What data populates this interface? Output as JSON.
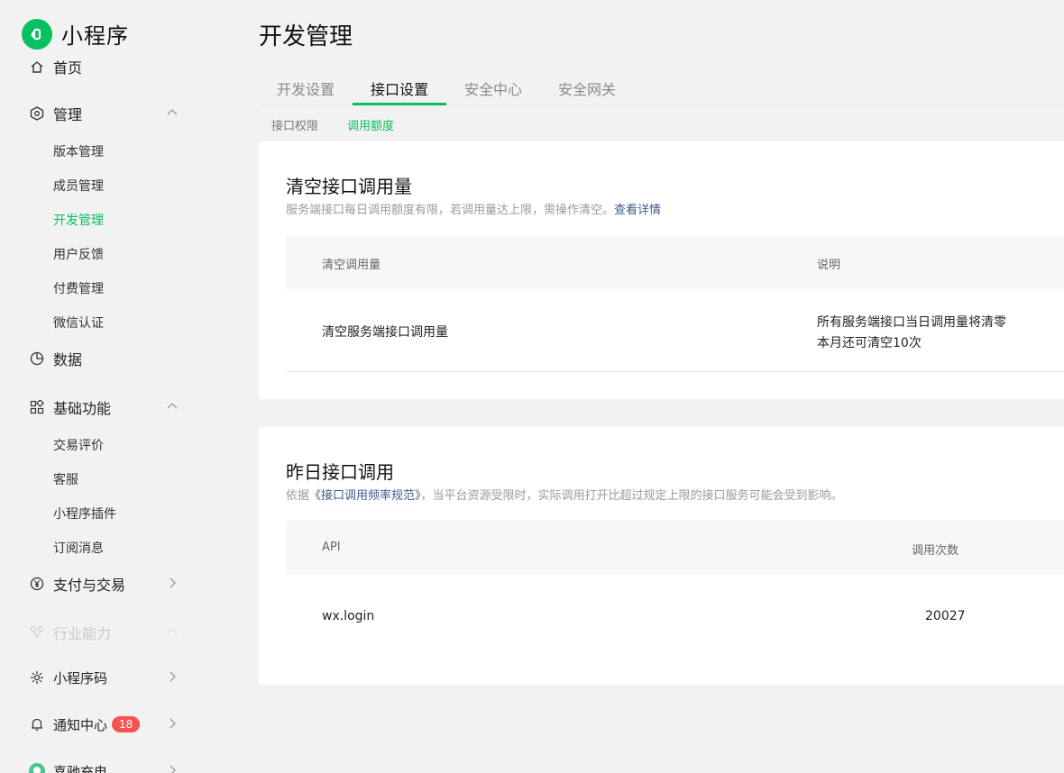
{
  "app": {
    "name": "小程序"
  },
  "sidebar": {
    "home_label": "首页",
    "groups": {
      "manage": {
        "label": "管理",
        "items": [
          "版本管理",
          "成员管理",
          "开发管理",
          "用户反馈",
          "付费管理",
          "微信认证"
        ],
        "active": "开发管理"
      },
      "data": {
        "label": "数据"
      },
      "basic": {
        "label": "基础功能",
        "items": [
          "交易评价",
          "客服",
          "小程序插件",
          "订阅消息"
        ]
      },
      "pay": {
        "label": "支付与交易"
      },
      "industry": {
        "label": "行业能力"
      },
      "qrcode": {
        "label": "小程序码"
      },
      "notify": {
        "label": "通知中心",
        "badge": "18"
      },
      "account": {
        "label": "喜驰充电"
      }
    }
  },
  "page": {
    "title": "开发管理",
    "tabs": [
      "开发设置",
      "接口设置",
      "安全中心",
      "安全网关"
    ],
    "active_tab": "接口设置",
    "subtabs": [
      "接口权限",
      "调用额度"
    ],
    "active_subtab": "调用额度"
  },
  "clear_card": {
    "title": "清空接口调用量",
    "desc": "服务端接口每日调用额度有限，若调用量达上限，需操作清空。",
    "desc_link": "查看详情",
    "columns": [
      "清空调用量",
      "说明"
    ],
    "row": {
      "name": "清空服务端接口调用量",
      "note_line1": "所有服务端接口当日调用量将清零",
      "note_line2": "本月还可清空10次"
    }
  },
  "yesterday_card": {
    "title": "昨日接口调用",
    "desc_prefix": "依据",
    "desc_link": "《接口调用频率规范》",
    "desc_suffix": "，当平台资源受限时，实际调用打开比超过规定上限的接口服务可能会受到影响。",
    "columns": [
      "API",
      "调用次数"
    ],
    "rows": [
      {
        "api": "wx.login",
        "count": "20027"
      }
    ]
  },
  "colors": {
    "accent": "#07c160",
    "link": "#3f5a8a",
    "badge": "#fa5151"
  }
}
